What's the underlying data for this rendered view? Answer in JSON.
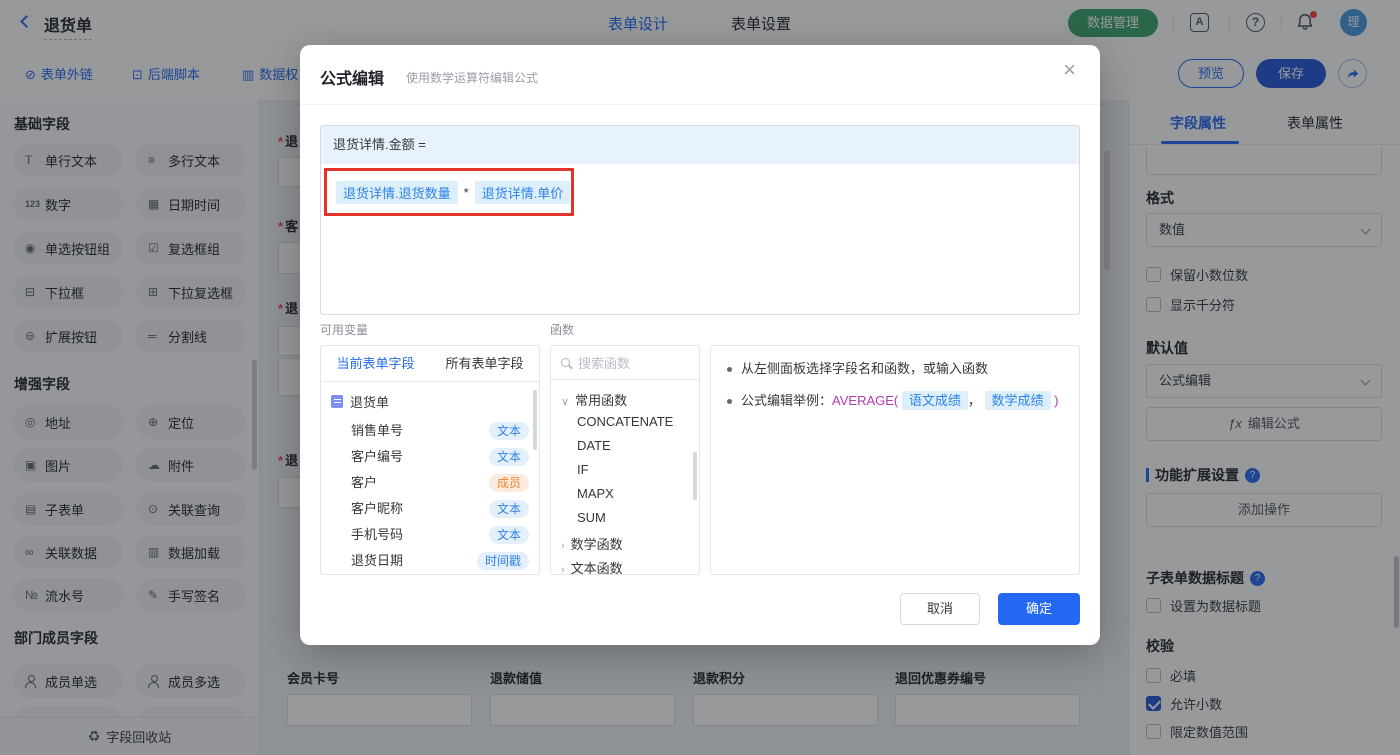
{
  "header": {
    "back_label": "退货单",
    "tabs": [
      {
        "label": "表单设计"
      },
      {
        "label": "表单设置"
      }
    ],
    "data_manage_label": "数据管理",
    "avatar_text": "理"
  },
  "toolbar": {
    "links": [
      {
        "label": "表单外链",
        "icon": "⊘"
      },
      {
        "label": "后端脚本",
        "icon": "⊡"
      },
      {
        "label": "数据权",
        "icon": "▥"
      }
    ],
    "preview_label": "预览",
    "save_label": "保存"
  },
  "sidebar": {
    "sections": [
      {
        "title": "基础字段",
        "items": [
          {
            "label": "单行文本",
            "icon": "T"
          },
          {
            "label": "多行文本",
            "icon": "≡"
          },
          {
            "label": "数字",
            "icon": "123"
          },
          {
            "label": "日期时间",
            "icon": "▦"
          },
          {
            "label": "单选按钮组",
            "icon": "◉"
          },
          {
            "label": "复选框组",
            "icon": "☑"
          },
          {
            "label": "下拉框",
            "icon": "⊟"
          },
          {
            "label": "下拉复选框",
            "icon": "⊞"
          },
          {
            "label": "扩展按钮",
            "icon": "⊜"
          },
          {
            "label": "分割线",
            "icon": "═"
          }
        ]
      },
      {
        "title": "增强字段",
        "items": [
          {
            "label": "地址",
            "icon": "◎"
          },
          {
            "label": "定位",
            "icon": "⊕"
          },
          {
            "label": "图片",
            "icon": "▣"
          },
          {
            "label": "附件",
            "icon": "☁"
          },
          {
            "label": "子表单",
            "icon": "▤"
          },
          {
            "label": "关联查询",
            "icon": "⊙"
          },
          {
            "label": "关联数据",
            "icon": "∞"
          },
          {
            "label": "数据加载",
            "icon": "▥"
          },
          {
            "label": "流水号",
            "icon": "№"
          },
          {
            "label": "手写签名",
            "icon": "✎"
          }
        ]
      },
      {
        "title": "部门成员字段",
        "items": [
          {
            "label": "成员单选"
          },
          {
            "label": "成员多选"
          }
        ]
      }
    ],
    "recycle_label": "字段回收站",
    "recycle_icon": "♻"
  },
  "canvas": {
    "required_mark": "*",
    "partial_rows": [
      {
        "label": "退"
      },
      {
        "label": "客"
      },
      {
        "label": "退"
      },
      {
        "label": "退"
      }
    ],
    "bottom_fields": [
      {
        "label": "会员卡号"
      },
      {
        "label": "退款储值"
      },
      {
        "label": "退款积分"
      },
      {
        "label": "退回优惠券编号"
      }
    ]
  },
  "modal": {
    "title": "公式编辑",
    "subtitle": "使用数学运算符编辑公式",
    "formula_target": "退货详情.金额 =",
    "formula_tokens": {
      "field1": "退货详情.退货数量",
      "operator": "*",
      "field2": "退货详情.单价"
    },
    "variables": {
      "label": "可用变量",
      "tabs": [
        {
          "label": "当前表单字段"
        },
        {
          "label": "所有表单字段"
        }
      ],
      "root": "退货单",
      "fields": [
        {
          "name": "销售单号",
          "badge": "文本"
        },
        {
          "name": "客户编号",
          "badge": "文本"
        },
        {
          "name": "客户",
          "badge": "成员",
          "member": true
        },
        {
          "name": "客户昵称",
          "badge": "文本"
        },
        {
          "name": "手机号码",
          "badge": "文本"
        },
        {
          "name": "退货日期",
          "badge": "时间戳"
        }
      ]
    },
    "functions": {
      "label": "函数",
      "search_placeholder": "搜索函数",
      "groups": [
        {
          "label": "常用函数",
          "items": [
            "CONCATENATE",
            "DATE",
            "IF",
            "MAPX",
            "SUM"
          ]
        },
        {
          "label": "数学函数"
        },
        {
          "label": "文本函数"
        }
      ]
    },
    "tips": {
      "line1": "从左侧面板选择字段名和函数，或输入函数",
      "line2_prefix": "公式编辑举例：",
      "line2_func": "AVERAGE(",
      "line2_chip1": "语文成绩",
      "line2_comma": "，",
      "line2_chip2": "数学成绩",
      "line2_close": ")"
    },
    "cancel_label": "取消",
    "confirm_label": "确定"
  },
  "right_panel": {
    "tabs": [
      {
        "label": "字段属性"
      },
      {
        "label": "表单属性"
      }
    ],
    "format_label": "格式",
    "format_value": "数值",
    "format_options": [
      {
        "label": "保留小数位数",
        "checked": false
      },
      {
        "label": "显示千分符",
        "checked": false
      }
    ],
    "default_label": "默认值",
    "default_value": "公式编辑",
    "edit_formula_label": "编辑公式",
    "ext_section_label": "功能扩展设置",
    "add_action_label": "添加操作",
    "subform_title_label": "子表单数据标题",
    "subform_checkbox": {
      "label": "设置为数据标题",
      "checked": false
    },
    "validation_label": "校验",
    "validation_options": [
      {
        "label": "必填",
        "checked": false
      },
      {
        "label": "允许小数",
        "checked": true
      },
      {
        "label": "限定数值范围",
        "checked": false
      }
    ]
  },
  "icons": {
    "help": "?",
    "close": "×",
    "lang": "A",
    "fx": "ƒx",
    "expanded_chev": "∨",
    "collapsed_chev": "›"
  },
  "colors": {
    "primary": "#2468f2",
    "save_blue": "#2157d8",
    "green": "#3aa36c",
    "annotation_red": "#e2342a",
    "chip_text": "#2e82e8",
    "member_orange": "#e98636"
  }
}
